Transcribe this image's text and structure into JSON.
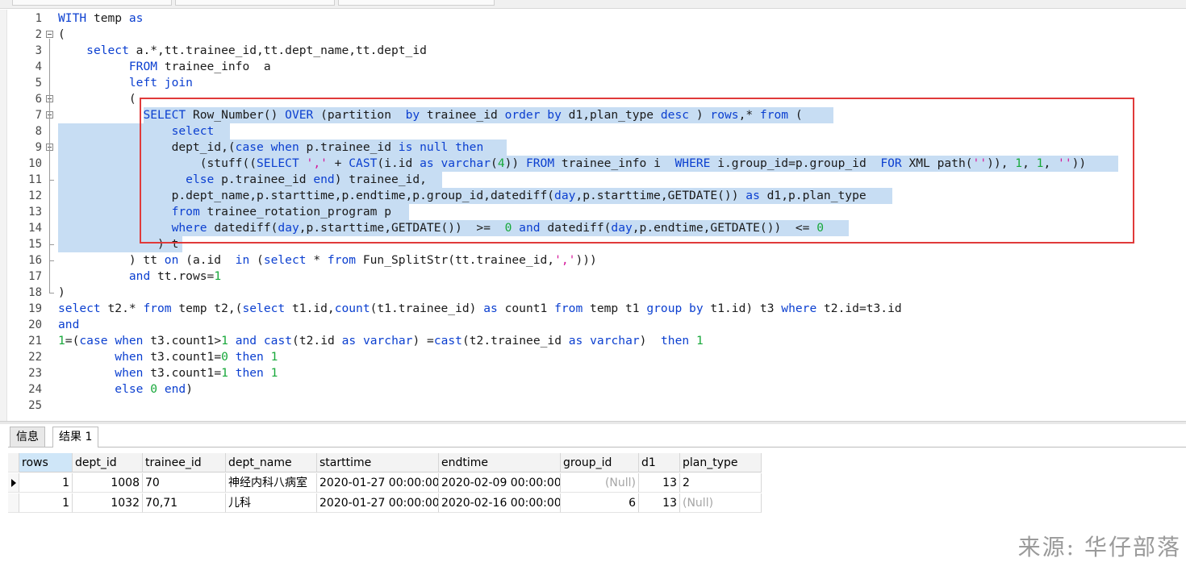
{
  "editor": {
    "lines": [
      {
        "n": "1",
        "html": "<span class='k'>WITH</span> temp <span class='k'>as</span>"
      },
      {
        "n": "2",
        "html": "("
      },
      {
        "n": "3",
        "html": "    <span class='k'>select</span> a.*,tt.trainee_id,tt.dept_name,tt.dept_id"
      },
      {
        "n": "4",
        "html": "          <span class='k'>FROM</span> trainee_info  a"
      },
      {
        "n": "5",
        "html": "          <span class='k'>left join</span>"
      },
      {
        "n": "6",
        "html": "          ("
      },
      {
        "n": "7",
        "html": "            <span class='k'>SELECT</span> Row_Number() <span class='k'>OVER</span> (partition  <span class='k'>by</span> trainee_id <span class='k'>order by</span> d1,plan_type <span class='k'>desc</span> ) <span class='k'>rows</span>,* <span class='k'>from</span> ("
      },
      {
        "n": "8",
        "html": "                <span class='k'>select</span>"
      },
      {
        "n": "9",
        "html": "                dept_id,(<span class='k'>case</span> <span class='k'>when</span> p.trainee_id <span class='k'>is null</span> <span class='k'>then</span>"
      },
      {
        "n": "10",
        "html": "                    (stuff((<span class='k'>SELECT</span> <span class='s'>','</span> + <span class='f'>CAST</span>(i.id <span class='k'>as</span> <span class='k'>varchar</span>(<span class='n'>4</span>)) <span class='k'>FROM</span> trainee_info i  <span class='k'>WHERE</span> i.group_id=p.group_id  <span class='k'>FOR</span> XML path(<span class='s'>''</span>)), <span class='n'>1</span>, <span class='n'>1</span>, <span class='s'>''</span>))"
      },
      {
        "n": "11",
        "html": "                  <span class='k'>else</span> p.trainee_id <span class='k'>end</span>) trainee_id,"
      },
      {
        "n": "12",
        "html": "                p.dept_name,p.starttime,p.endtime,p.group_id,datediff(<span class='k'>day</span>,p.starttime,GETDATE()) <span class='k'>as</span> d1,p.plan_type"
      },
      {
        "n": "13",
        "html": "                <span class='k'>from</span> trainee_rotation_program p"
      },
      {
        "n": "14",
        "html": "                <span class='k'>where</span> datediff(<span class='k'>day</span>,p.starttime,GETDATE())  >=  <span class='n'>0</span> <span class='k'>and</span> datediff(<span class='k'>day</span>,p.endtime,GETDATE())  <= <span class='n'>0</span>"
      },
      {
        "n": "15",
        "html": "              ) t"
      },
      {
        "n": "16",
        "html": "          ) tt <span class='k'>on</span> (a.id  <span class='k'>in</span> (<span class='k'>select</span> * <span class='k'>from</span> Fun_SplitStr(tt.trainee_id,<span class='s'>','</span>)))"
      },
      {
        "n": "17",
        "html": "          <span class='k'>and</span> tt.rows=<span class='n'>1</span>"
      },
      {
        "n": "18",
        "html": ")"
      },
      {
        "n": "19",
        "html": "<span class='k'>select</span> t2.* <span class='k'>from</span> temp t2,(<span class='k'>select</span> t1.id,<span class='f'>count</span>(t1.trainee_id) <span class='k'>as</span> count1 <span class='k'>from</span> temp t1 <span class='k'>group by</span> t1.id) t3 <span class='k'>where</span> t2.id=t3.id"
      },
      {
        "n": "20",
        "html": "<span class='k'>and</span>"
      },
      {
        "n": "21",
        "html": "<span class='n'>1</span>=(<span class='k'>case</span> <span class='k'>when</span> t3.count1><span class='n'>1</span> <span class='k'>and</span> <span class='f'>cast</span>(t2.id <span class='k'>as</span> <span class='k'>varchar</span>) =<span class='f'>cast</span>(t2.trainee_id <span class='k'>as</span> <span class='k'>varchar</span>)  <span class='k'>then</span> <span class='n'>1</span>"
      },
      {
        "n": "22",
        "html": "        <span class='k'>when</span> t3.count1=<span class='n'>0</span> <span class='k'>then</span> <span class='n'>1</span>"
      },
      {
        "n": "23",
        "html": "        <span class='k'>when</span> t3.count1=<span class='n'>1</span> <span class='k'>then</span> <span class='n'>1</span>"
      },
      {
        "n": "24",
        "html": "        <span class='k'>else</span> <span class='n'>0</span> <span class='k'>end</span>)"
      },
      {
        "n": "25",
        "html": ""
      }
    ]
  },
  "results": {
    "tabs": [
      "信息",
      "结果 1"
    ],
    "active_tab": "结果 1",
    "columns": [
      "rows",
      "dept_id",
      "trainee_id",
      "dept_name",
      "starttime",
      "endtime",
      "group_id",
      "d1",
      "plan_type"
    ],
    "rows": [
      [
        "1",
        "1008",
        "70",
        "神经内科八病室",
        "2020-01-27 00:00:00",
        "2020-02-09 00:00:00",
        "(Null)",
        "13",
        "2"
      ],
      [
        "1",
        "1032",
        "70,71",
        "儿科",
        "2020-01-27 00:00:00",
        "2020-02-16 00:00:00",
        "6",
        "13",
        "(Null)"
      ]
    ]
  },
  "watermark": "来源: 华仔部落"
}
